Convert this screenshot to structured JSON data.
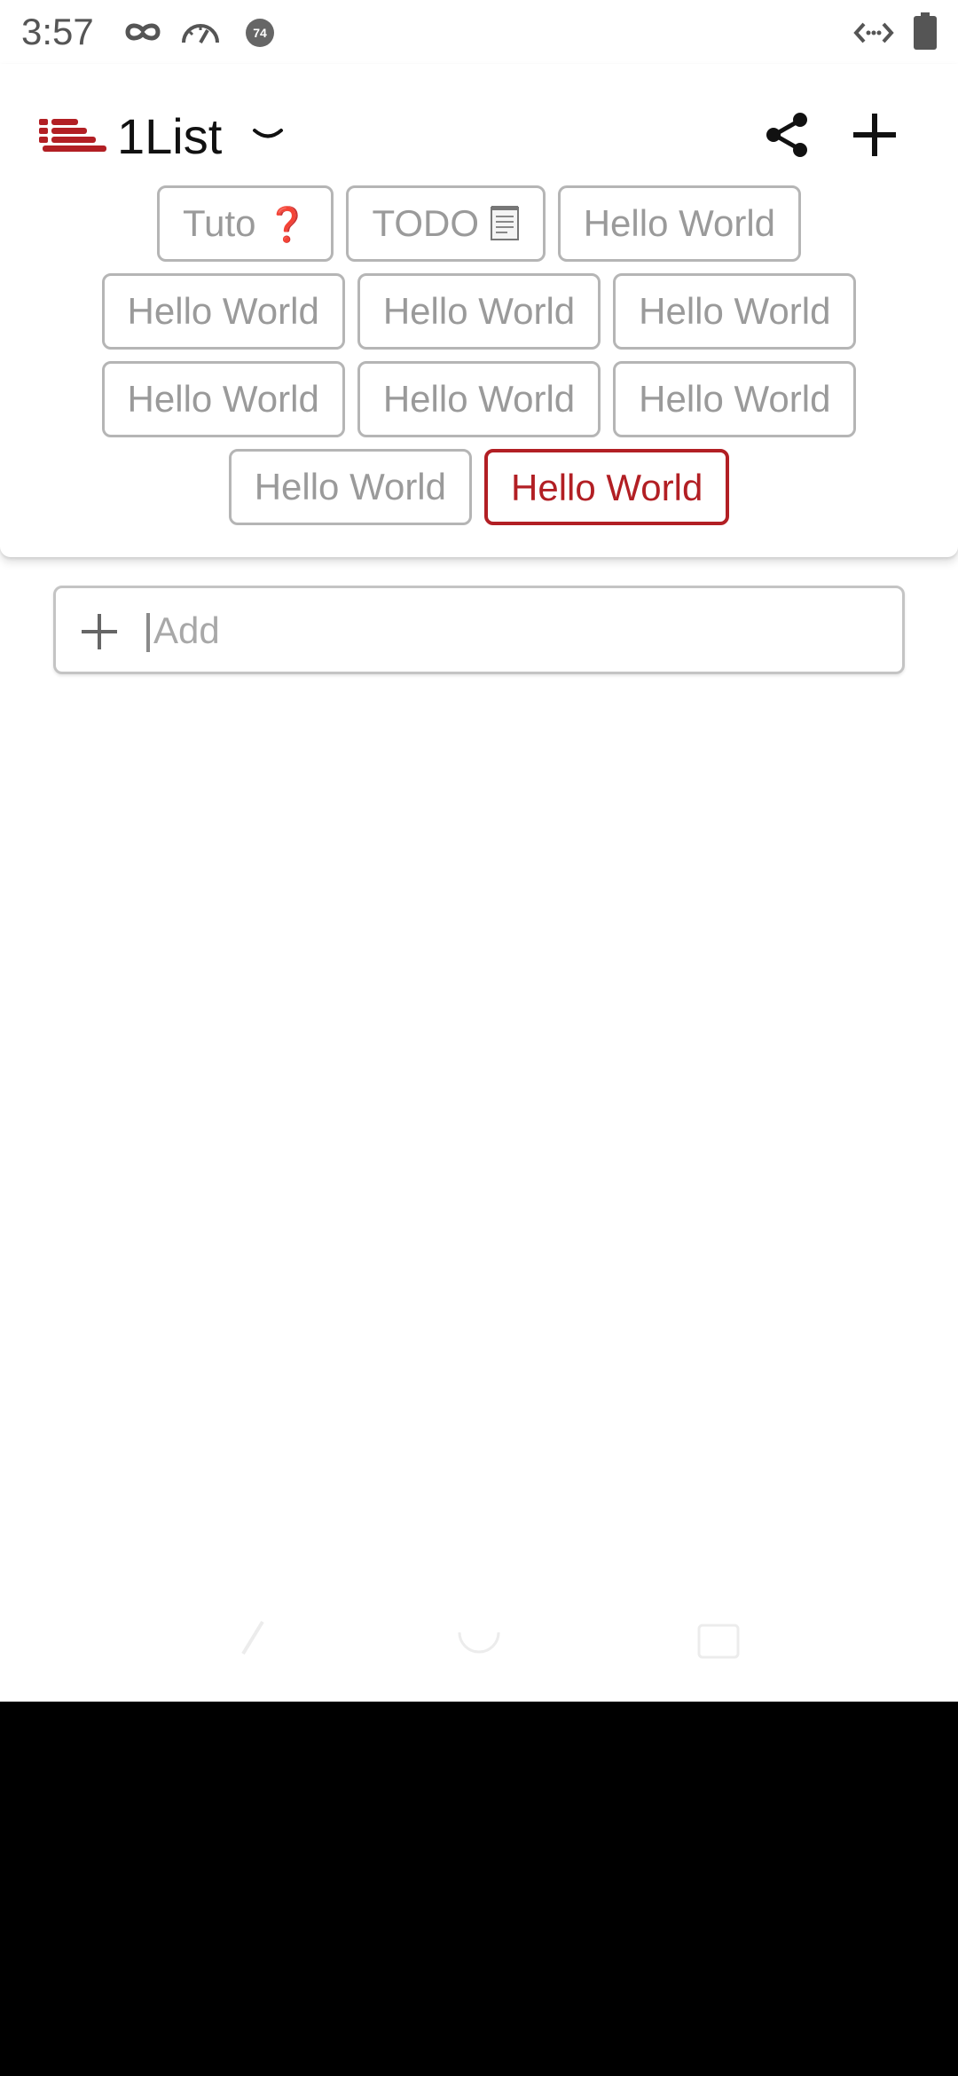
{
  "status_bar": {
    "time": "3:57",
    "badge": "74",
    "icons": [
      "incognito-icon",
      "speedometer-icon",
      "notification-badge-icon",
      "code-arrows-icon",
      "battery-icon"
    ]
  },
  "header": {
    "app_title": "1List",
    "logo_icon": "list-logo-icon",
    "actions": [
      "share-icon",
      "plus-icon"
    ]
  },
  "chips": {
    "rows": [
      [
        {
          "label": "Tuto",
          "emoji": "❓",
          "selected": false
        },
        {
          "label": "TODO",
          "emoji": "📄",
          "selected": false
        },
        {
          "label": "Hello World",
          "emoji": "",
          "selected": false
        }
      ],
      [
        {
          "label": "Hello World",
          "emoji": "",
          "selected": false
        },
        {
          "label": "Hello World",
          "emoji": "",
          "selected": false
        },
        {
          "label": "Hello World",
          "emoji": "",
          "selected": false
        }
      ],
      [
        {
          "label": "Hello World",
          "emoji": "",
          "selected": false
        },
        {
          "label": "Hello World",
          "emoji": "",
          "selected": false
        },
        {
          "label": "Hello World",
          "emoji": "",
          "selected": false
        }
      ],
      [
        {
          "label": "Hello World",
          "emoji": "",
          "selected": false
        },
        {
          "label": "Hello World",
          "emoji": "",
          "selected": true
        }
      ]
    ]
  },
  "add_item": {
    "placeholder": "Add",
    "value": ""
  },
  "colors": {
    "accent": "#b21f24",
    "chip_border": "#b5b5b5",
    "chip_text": "#9a9a9a"
  }
}
